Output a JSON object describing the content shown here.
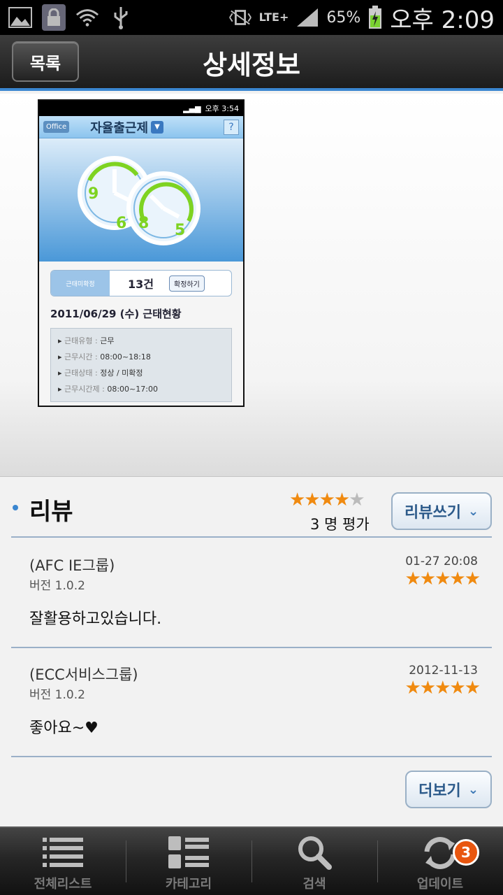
{
  "status_bar": {
    "network": "LTE+",
    "battery": "65%",
    "time": "오후 2:09"
  },
  "header": {
    "back_label": "목록",
    "title": "상세정보"
  },
  "screenshot": {
    "status_time": "오후 3:54",
    "app_logo": "Office",
    "app_title": "자율출근제",
    "help": "?",
    "bar_label": "근태미확정",
    "bar_count": "13건",
    "bar_button": "확정하기",
    "date_line": "2011/06/29 (수) 근태현황",
    "rows": [
      {
        "key": "근태유형 :",
        "value": "근무"
      },
      {
        "key": "근무시간 :",
        "value": "08:00~18:18"
      },
      {
        "key": "근태상태 :",
        "value": "정상 / 미확정"
      },
      {
        "key": "근무시간제 :",
        "value": "08:00~17:00"
      }
    ],
    "clock_numbers": [
      "9",
      "6",
      "8",
      "5"
    ]
  },
  "reviews_section": {
    "title": "리뷰",
    "average_rating": 4.5,
    "rating_count": "3 명 평가",
    "write_button": "리뷰쓰기",
    "more_button": "더보기"
  },
  "reviews": [
    {
      "author": "(AFC IE그룹)",
      "version": "버전 1.0.2",
      "date": "01-27 20:08",
      "rating": 5,
      "text": "잘활용하고있습니다."
    },
    {
      "author": "(ECC서비스그룹)",
      "version": "버전 1.0.2",
      "date": "2012-11-13",
      "rating": 5,
      "text": "좋아요~♥"
    }
  ],
  "bottom_nav": {
    "items": [
      {
        "label": "전체리스트",
        "icon": "list-icon"
      },
      {
        "label": "카테고리",
        "icon": "category-grid-icon"
      },
      {
        "label": "검색",
        "icon": "search-icon"
      },
      {
        "label": "업데이트",
        "icon": "update-sync-icon"
      }
    ],
    "update_badge": "3"
  },
  "colors": {
    "accent": "#3a86d0",
    "star": "#f08a10",
    "badge": "#e8560f"
  }
}
